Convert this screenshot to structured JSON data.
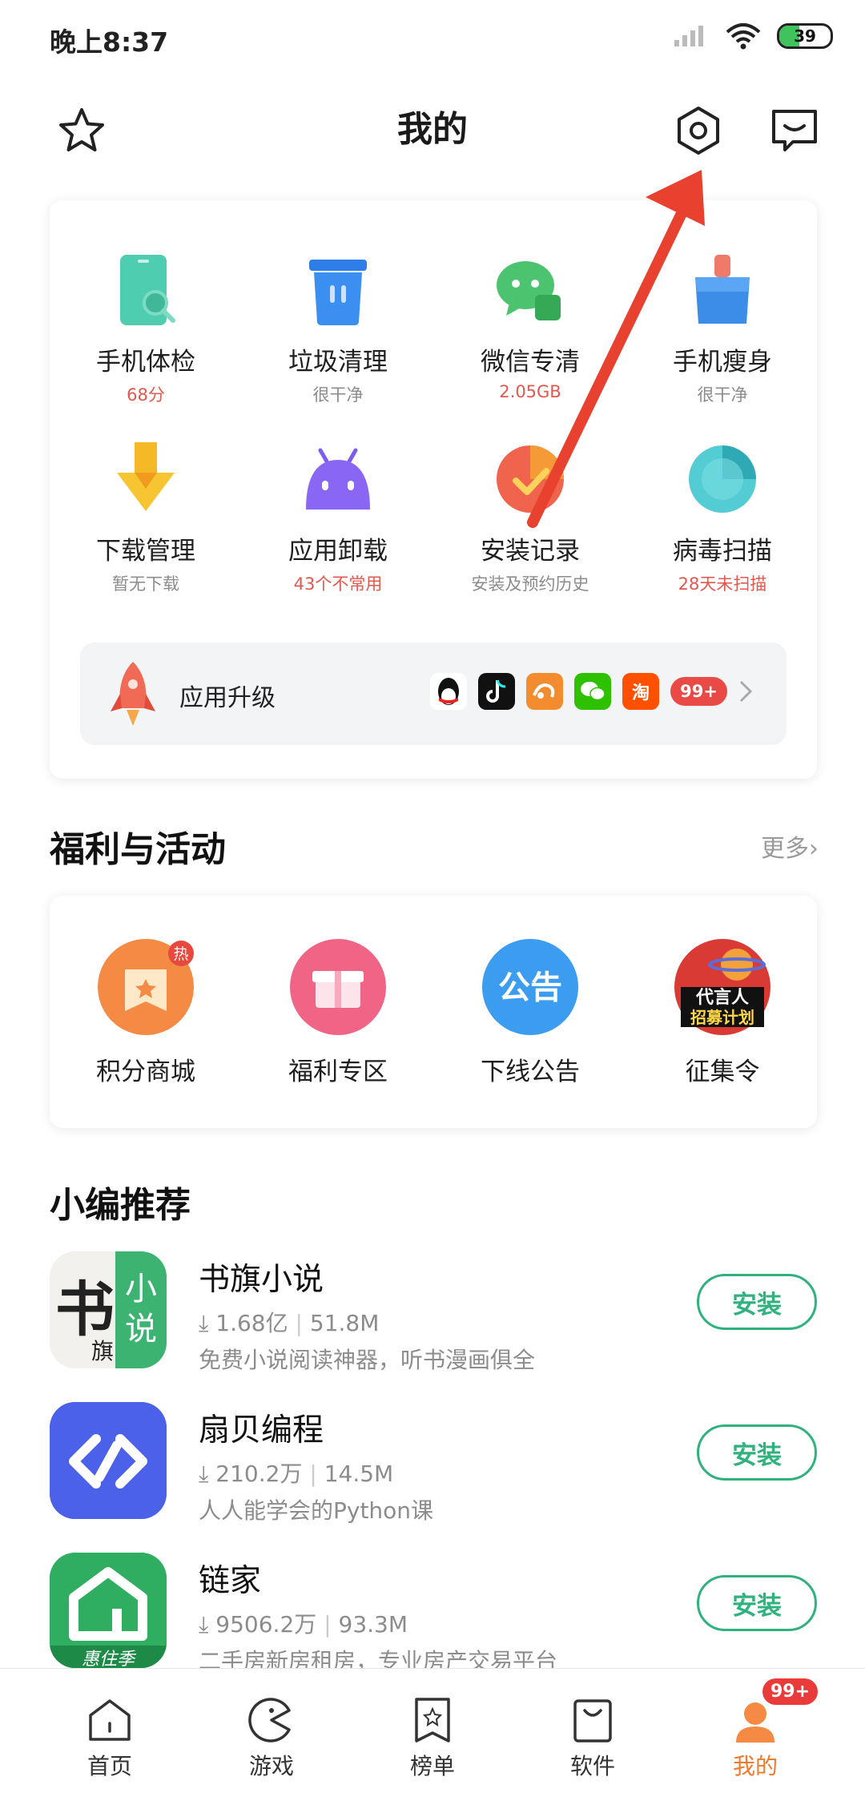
{
  "status_bar": {
    "time": "晚上8:37",
    "battery": "39"
  },
  "header": {
    "title": "我的",
    "icons": [
      "star-icon",
      "settings-hexagon-icon",
      "message-icon"
    ]
  },
  "tools": [
    {
      "name": "手机体检",
      "sub": "68分",
      "sub_color": "#e2584d",
      "icon": "phone-check-icon"
    },
    {
      "name": "垃圾清理",
      "sub": "很干净",
      "sub_color": "#8c8c8c",
      "icon": "trash-icon"
    },
    {
      "name": "微信专清",
      "sub": "2.05GB",
      "sub_color": "#e2584d",
      "icon": "wechat-clean-icon"
    },
    {
      "name": "手机瘦身",
      "sub": "很干净",
      "sub_color": "#8c8c8c",
      "icon": "brush-icon"
    },
    {
      "name": "下载管理",
      "sub": "暂无下载",
      "sub_color": "#8c8c8c",
      "icon": "download-icon"
    },
    {
      "name": "应用卸载",
      "sub": "43个不常用",
      "sub_color": "#e2584d",
      "icon": "android-icon"
    },
    {
      "name": "安装记录",
      "sub": "安装及预约历史",
      "sub_color": "#8c8c8c",
      "icon": "install-history-icon"
    },
    {
      "name": "病毒扫描",
      "sub": "28天未扫描",
      "sub_color": "#e2584d",
      "icon": "virus-scan-icon"
    }
  ],
  "upgrade": {
    "label": "应用升级",
    "badge": "99+",
    "apps": [
      "qq-icon",
      "douyin-icon",
      "uc-icon",
      "wechat-icon",
      "taobao-icon"
    ],
    "taobao_text": "淘"
  },
  "welfare": {
    "title": "福利与活动",
    "more": "更多",
    "items": [
      {
        "name": "积分商城",
        "icon": "points-mall-icon",
        "hot": "热"
      },
      {
        "name": "福利专区",
        "icon": "gift-icon"
      },
      {
        "name": "下线公告",
        "icon": "announcement-icon",
        "icon_text": "公告"
      },
      {
        "name": "征集令",
        "icon": "recruit-icon",
        "icon_text_1": "代言人",
        "icon_text_2": "招募计划"
      }
    ]
  },
  "recommend": {
    "title": "小编推荐",
    "install_label": "安装",
    "apps": [
      {
        "name": "书旗小说",
        "downloads": "1.68亿",
        "size": "51.8M",
        "desc": "免费小说阅读神器，听书漫画俱全",
        "icon_main": "书",
        "icon_sub1": "小",
        "icon_sub2": "说",
        "icon_sub3": "旗"
      },
      {
        "name": "扇贝编程",
        "downloads": "210.2万",
        "size": "14.5M",
        "desc": "人人能学会的Python课"
      },
      {
        "name": "链家",
        "downloads": "9506.2万",
        "size": "93.3M",
        "desc": "二手房新房租房，专业房产交易平台",
        "icon_banner": "惠住季"
      }
    ]
  },
  "bottom_nav": {
    "items": [
      {
        "label": "首页",
        "icon": "home-icon"
      },
      {
        "label": "游戏",
        "icon": "game-icon"
      },
      {
        "label": "榜单",
        "icon": "ranking-icon"
      },
      {
        "label": "软件",
        "icon": "software-bag-icon"
      },
      {
        "label": "我的",
        "icon": "profile-icon",
        "badge": "99+"
      }
    ]
  },
  "colors": {
    "accent_green": "#2fb27d",
    "accent_red": "#e2584d",
    "nav_active": "#ef7a2c",
    "annotation_arrow": "#e8412f"
  }
}
